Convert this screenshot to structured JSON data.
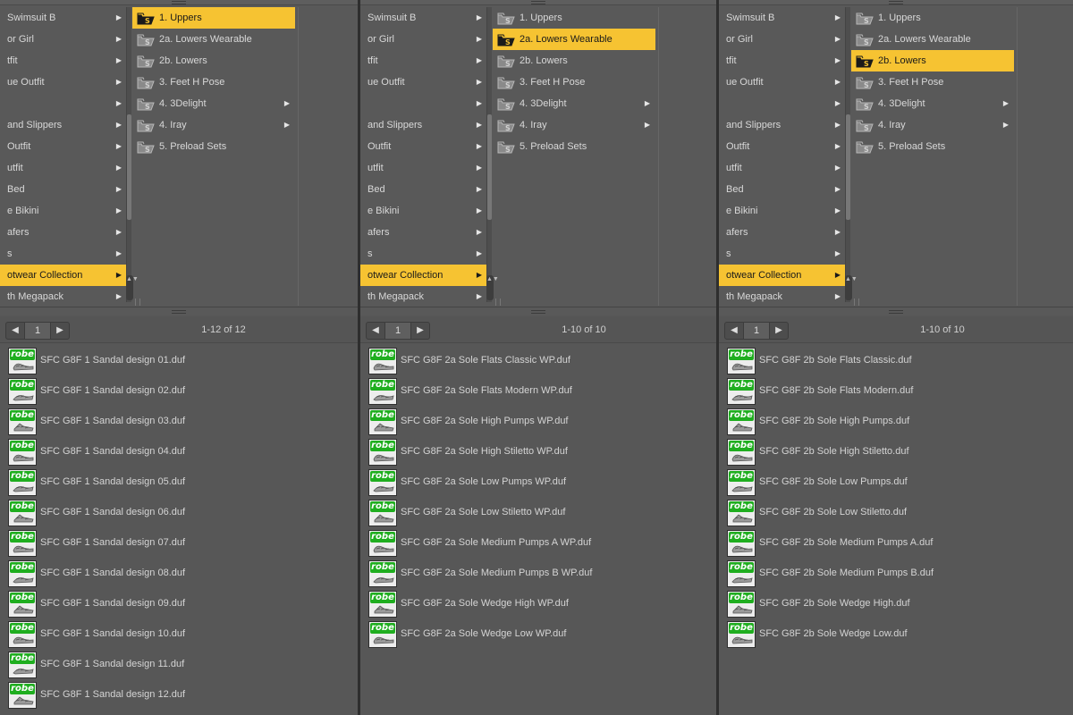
{
  "icons": {
    "submenu_arrow": "▶",
    "page_prev": "◀",
    "page_next": "▶",
    "scroll_knob": "▲▼",
    "folder": "folder-icon",
    "thumbnail": "robe-thumbnail"
  },
  "colors": {
    "selection": "#f6c332",
    "panel_bg": "#575757",
    "robe_badge": "#1fae1f"
  },
  "panels": [
    {
      "categories": [
        {
          "label": "Swimsuit B",
          "has_sub": true
        },
        {
          "label": "or Girl",
          "has_sub": true
        },
        {
          "label": "tfit",
          "has_sub": true
        },
        {
          "label": "ue Outfit",
          "has_sub": true
        },
        {
          "label": "",
          "has_sub": true
        },
        {
          "label": "and Slippers",
          "has_sub": true
        },
        {
          "label": "Outfit",
          "has_sub": true
        },
        {
          "label": "utfit",
          "has_sub": true
        },
        {
          "label": "Bed",
          "has_sub": true
        },
        {
          "label": "e Bikini",
          "has_sub": true
        },
        {
          "label": "afers",
          "has_sub": true
        },
        {
          "label": "s",
          "has_sub": true
        },
        {
          "label": "otwear Collection",
          "has_sub": true,
          "selected": true
        },
        {
          "label": "th Megapack",
          "has_sub": true
        }
      ],
      "subfolders": [
        {
          "label": "1. Uppers",
          "selected": true
        },
        {
          "label": "2a. Lowers Wearable"
        },
        {
          "label": "2b. Lowers"
        },
        {
          "label": "3. Feet H Pose"
        },
        {
          "label": "4. 3Delight",
          "has_sub": true
        },
        {
          "label": "4. Iray",
          "has_sub": true
        },
        {
          "label": "5. Preload Sets"
        }
      ],
      "page": "1",
      "count": "1-12 of 12",
      "files": [
        "SFC G8F 1 Sandal design 01.duf",
        "SFC G8F 1 Sandal design 02.duf",
        "SFC G8F 1 Sandal design 03.duf",
        "SFC G8F 1 Sandal design 04.duf",
        "SFC G8F 1 Sandal design 05.duf",
        "SFC G8F 1 Sandal design 06.duf",
        "SFC G8F 1 Sandal design 07.duf",
        "SFC G8F 1 Sandal design 08.duf",
        "SFC G8F 1 Sandal design 09.duf",
        "SFC G8F 1 Sandal design 10.duf",
        "SFC G8F 1 Sandal design 11.duf",
        "SFC G8F 1 Sandal design 12.duf"
      ]
    },
    {
      "categories": [
        {
          "label": "Swimsuit B",
          "has_sub": true
        },
        {
          "label": "or Girl",
          "has_sub": true
        },
        {
          "label": "tfit",
          "has_sub": true
        },
        {
          "label": "ue Outfit",
          "has_sub": true
        },
        {
          "label": "",
          "has_sub": true
        },
        {
          "label": "and Slippers",
          "has_sub": true
        },
        {
          "label": "Outfit",
          "has_sub": true
        },
        {
          "label": "utfit",
          "has_sub": true
        },
        {
          "label": "Bed",
          "has_sub": true
        },
        {
          "label": "e Bikini",
          "has_sub": true
        },
        {
          "label": "afers",
          "has_sub": true
        },
        {
          "label": "s",
          "has_sub": true
        },
        {
          "label": "otwear Collection",
          "has_sub": true,
          "selected": true
        },
        {
          "label": "th Megapack",
          "has_sub": true
        }
      ],
      "subfolders": [
        {
          "label": "1. Uppers"
        },
        {
          "label": "2a. Lowers Wearable",
          "selected": true
        },
        {
          "label": "2b. Lowers"
        },
        {
          "label": "3. Feet H Pose"
        },
        {
          "label": "4. 3Delight",
          "has_sub": true
        },
        {
          "label": "4. Iray",
          "has_sub": true
        },
        {
          "label": "5. Preload Sets"
        }
      ],
      "page": "1",
      "count": "1-10 of 10",
      "files": [
        "SFC G8F 2a Sole Flats Classic WP.duf",
        "SFC G8F 2a Sole Flats Modern WP.duf",
        "SFC G8F 2a Sole High Pumps WP.duf",
        "SFC G8F 2a Sole High Stiletto WP.duf",
        "SFC G8F 2a Sole Low Pumps WP.duf",
        "SFC G8F 2a Sole Low Stiletto WP.duf",
        "SFC G8F 2a Sole Medium Pumps A WP.duf",
        "SFC G8F 2a Sole Medium Pumps B WP.duf",
        "SFC G8F 2a Sole Wedge High WP.duf",
        "SFC G8F 2a Sole Wedge Low WP.duf"
      ]
    },
    {
      "categories": [
        {
          "label": "Swimsuit B",
          "has_sub": true
        },
        {
          "label": "or Girl",
          "has_sub": true
        },
        {
          "label": "tfit",
          "has_sub": true
        },
        {
          "label": "ue Outfit",
          "has_sub": true
        },
        {
          "label": "",
          "has_sub": true
        },
        {
          "label": "and Slippers",
          "has_sub": true
        },
        {
          "label": "Outfit",
          "has_sub": true
        },
        {
          "label": "utfit",
          "has_sub": true
        },
        {
          "label": "Bed",
          "has_sub": true
        },
        {
          "label": "e Bikini",
          "has_sub": true
        },
        {
          "label": "afers",
          "has_sub": true
        },
        {
          "label": "s",
          "has_sub": true
        },
        {
          "label": "otwear Collection",
          "has_sub": true,
          "selected": true
        },
        {
          "label": "th Megapack",
          "has_sub": true
        }
      ],
      "subfolders": [
        {
          "label": "1. Uppers"
        },
        {
          "label": "2a. Lowers Wearable"
        },
        {
          "label": "2b. Lowers",
          "selected": true
        },
        {
          "label": "3. Feet H Pose"
        },
        {
          "label": "4. 3Delight",
          "has_sub": true
        },
        {
          "label": "4. Iray",
          "has_sub": true
        },
        {
          "label": "5. Preload Sets"
        }
      ],
      "page": "1",
      "count": "1-10 of 10",
      "files": [
        "SFC G8F 2b Sole Flats Classic.duf",
        "SFC G8F 2b Sole Flats Modern.duf",
        "SFC G8F 2b Sole High Pumps.duf",
        "SFC G8F 2b Sole High Stiletto.duf",
        "SFC G8F 2b Sole Low Pumps.duf",
        "SFC G8F 2b Sole Low Stiletto.duf",
        "SFC G8F 2b Sole Medium Pumps A.duf",
        "SFC G8F 2b Sole Medium Pumps B.duf",
        "SFC G8F 2b Sole Wedge High.duf",
        "SFC G8F 2b Sole Wedge Low.duf"
      ]
    }
  ]
}
